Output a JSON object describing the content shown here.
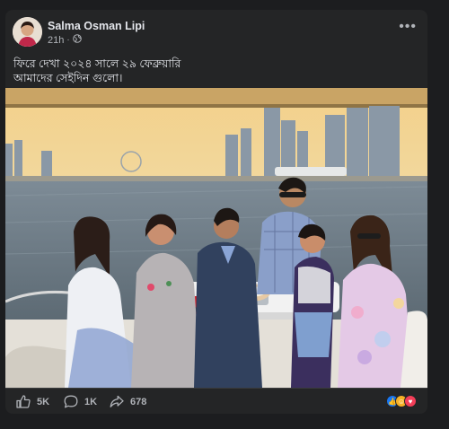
{
  "post": {
    "author": "Salma Osman Lipi",
    "time": "21h",
    "privacy_icon": "globe-icon",
    "caption_lines": [
      "ফিরে দেখা ২০২৪ সালে ২৯ ফেব্রুয়ারি",
      "আমাদের সেইদিন গুলো।"
    ]
  },
  "actions": {
    "like_count": "5K",
    "comment_count": "1K",
    "share_count": "678"
  },
  "reactions": [
    "like-icon",
    "haha-icon",
    "love-icon"
  ],
  "colors": {
    "background": "#1c1d1f",
    "card": "#242526",
    "text_primary": "#e4e6eb",
    "text_secondary": "#b0b3b8",
    "like_blue": "#1877f2",
    "love_red": "#f33e58",
    "haha_yellow": "#f7b125"
  }
}
